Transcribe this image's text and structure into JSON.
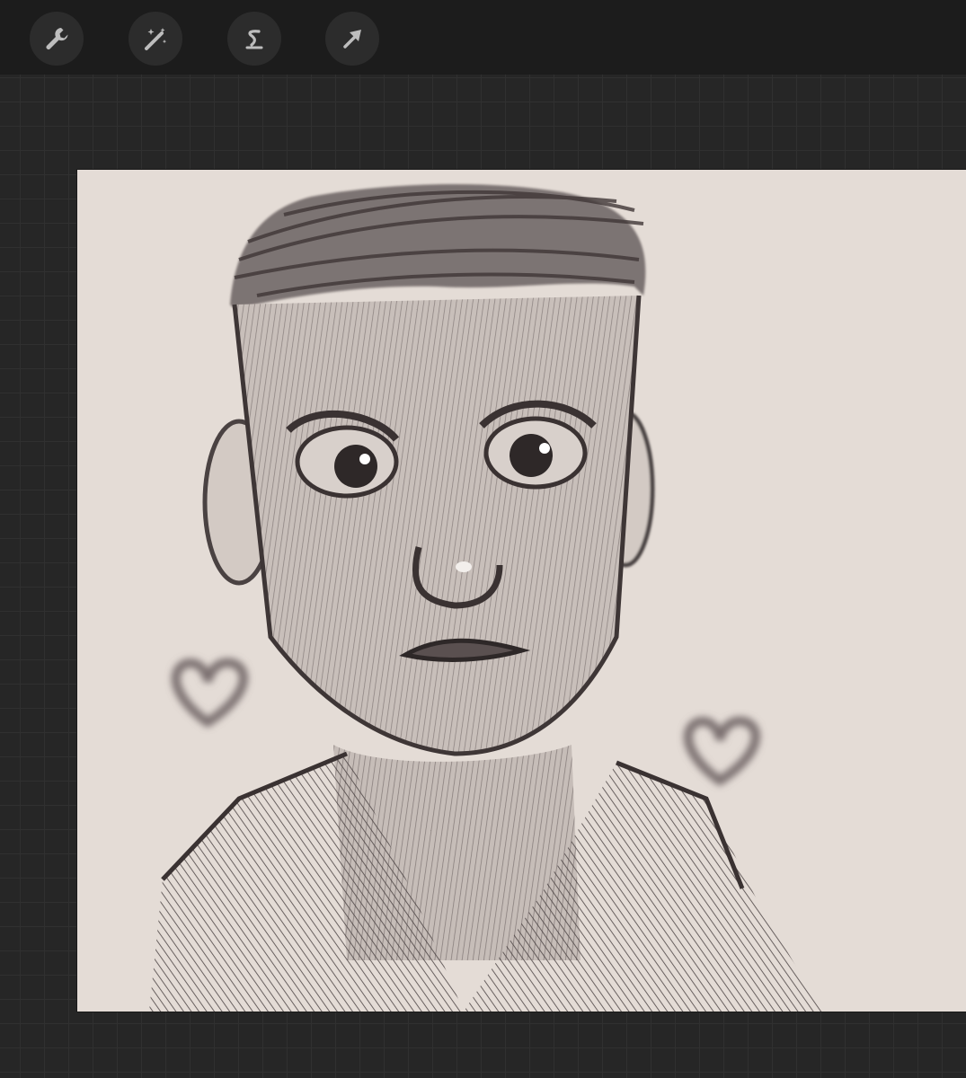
{
  "toolbar": {
    "tools": [
      {
        "icon": "wrench-icon",
        "name": "actions"
      },
      {
        "icon": "magic-wand-icon",
        "name": "adjustments"
      },
      {
        "icon": "selection-s-icon",
        "name": "selection"
      },
      {
        "icon": "arrow-cursor-icon",
        "name": "transform"
      }
    ]
  },
  "colors": {
    "toolbar_bg": "#1c1c1c",
    "workspace_bg": "#262626",
    "grid_line": "#303030",
    "canvas_paper": "#e4dcd6",
    "sketch_ink": "#4a4242"
  }
}
